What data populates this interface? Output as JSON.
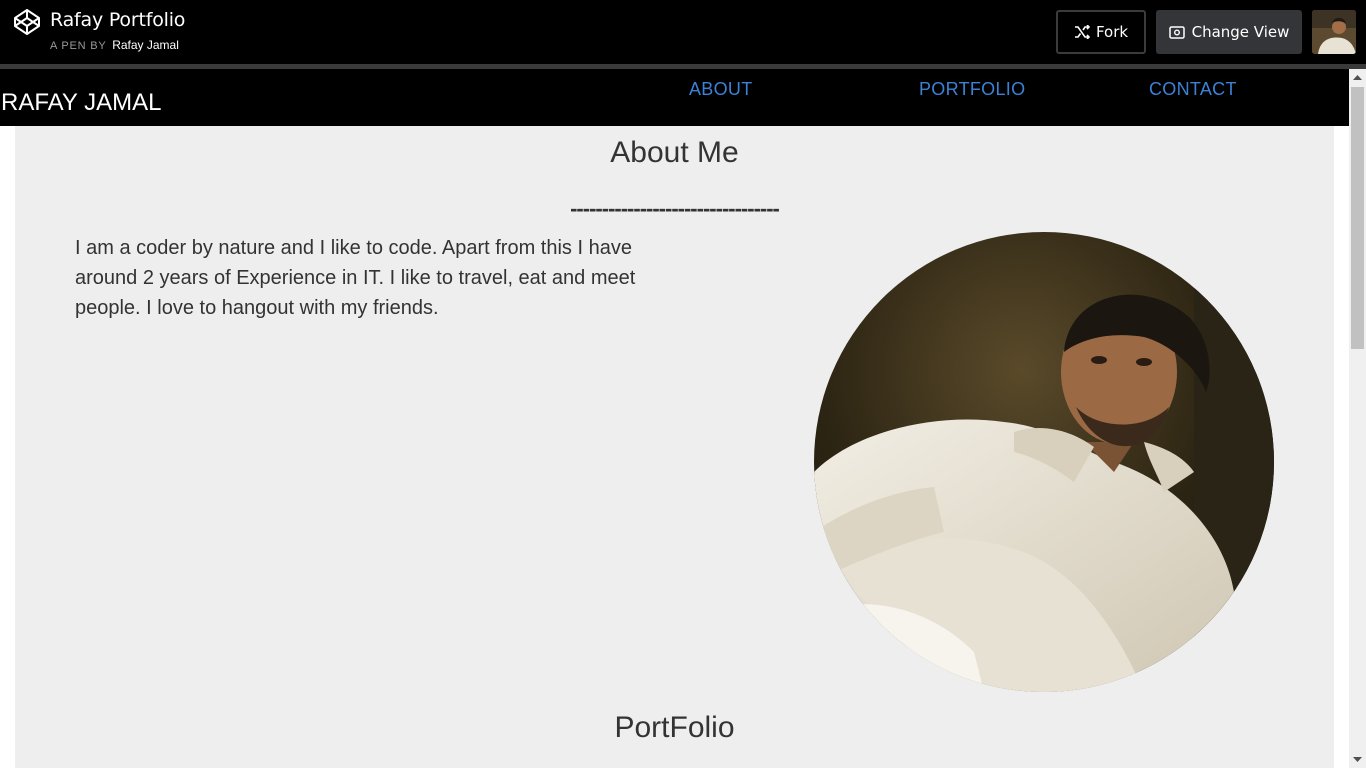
{
  "codepen": {
    "title": "Rafay Portfolio",
    "byline_prefix": "A PEN BY",
    "author": "Rafay Jamal",
    "fork_label": "Fork",
    "change_view_label": "Change View"
  },
  "site": {
    "brand": "RAFAY JAMAL",
    "nav": [
      "ABOUT",
      "PORTFOLIO",
      "CONTACT"
    ],
    "link_color": "#3b82d6"
  },
  "about": {
    "title": "About Me",
    "rule": "---------------------------------",
    "text": "I am a coder by nature and I like to code. Apart from this I have around 2 years of Experience in IT. I like to travel, eat and meet people. I love to hangout with my friends."
  },
  "portfolio": {
    "title": "PortFolio"
  },
  "colors": {
    "topbar": "#000000",
    "content_bg": "#eeeeee",
    "button_dark": "#333538"
  }
}
